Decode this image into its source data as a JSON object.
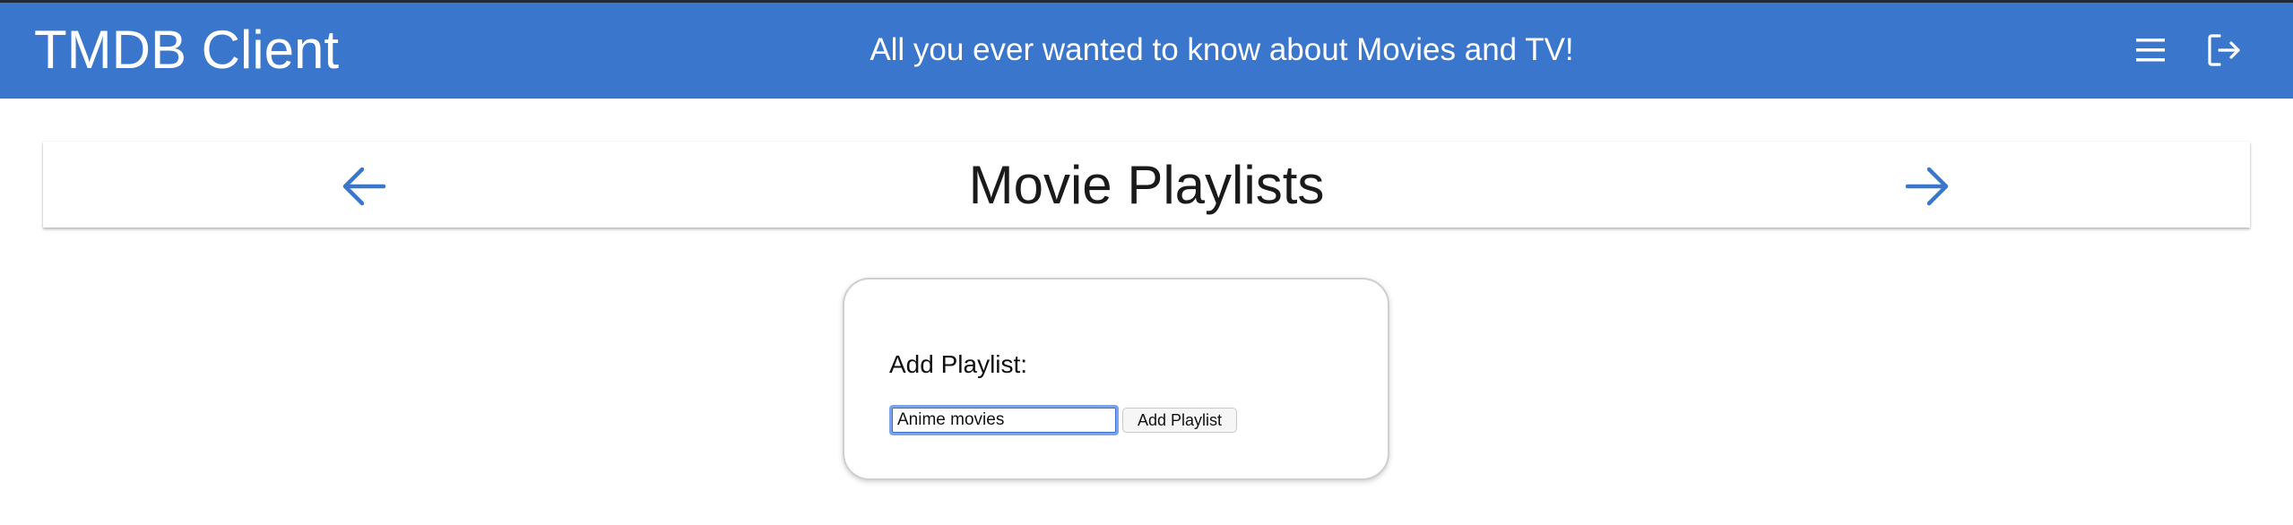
{
  "header": {
    "app_title": "TMDB Client",
    "tagline": "All you ever wanted to know about Movies and TV!",
    "icons": {
      "menu": "menu-icon",
      "logout": "logout-icon"
    }
  },
  "subnav": {
    "title": "Movie Playlists",
    "prev_icon": "arrow-left-icon",
    "next_icon": "arrow-right-icon"
  },
  "add_playlist": {
    "label": "Add Playlist:",
    "input_value": "Anime movies",
    "button_label": "Add Playlist"
  },
  "colors": {
    "header_bg": "#3a76cc",
    "accent": "#3a76cc",
    "text": "#1a1a1a"
  }
}
